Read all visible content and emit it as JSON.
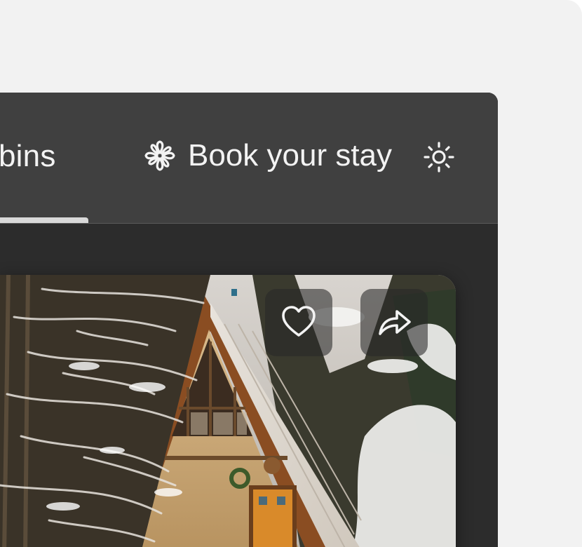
{
  "nav": {
    "active_tab_label": "bins",
    "book_button_label": "Book your stay"
  },
  "icons": {
    "book": "flower-icon",
    "theme": "sun-icon",
    "favorite": "heart-icon",
    "share": "share-arrow-icon"
  },
  "colors": {
    "page_background": "#f2f2f2",
    "header_background": "#404040",
    "content_background": "#2c2c2c",
    "header_text": "#f3f3f3"
  },
  "card": {
    "image_subject": "snow-covered A-frame cabin"
  }
}
